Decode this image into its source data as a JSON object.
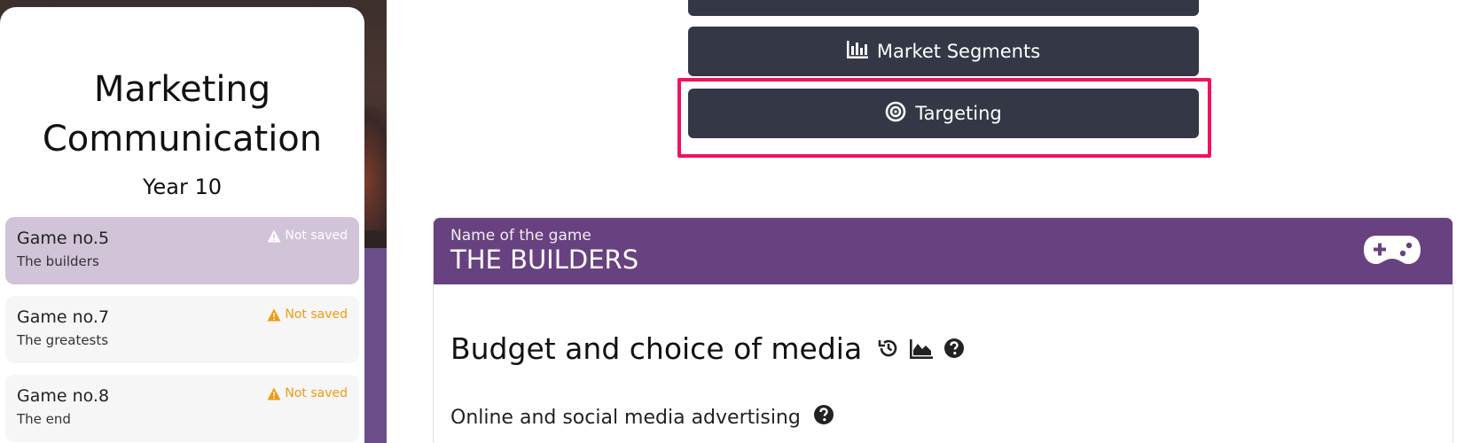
{
  "sidebar": {
    "title": "Marketing Communication",
    "year": "Year 10",
    "games": [
      {
        "title": "Game no.5",
        "subtitle": "The builders",
        "status": "Not saved",
        "active": true
      },
      {
        "title": "Game no.7",
        "subtitle": "The greatests",
        "status": "Not saved",
        "active": false
      },
      {
        "title": "Game no.8",
        "subtitle": "The end",
        "status": "Not saved",
        "active": false
      }
    ]
  },
  "nav_buttons": {
    "segments_label": "Market Segments",
    "targeting_label": "Targeting"
  },
  "game": {
    "name_label": "Name of the game",
    "name": "THE BUILDERS",
    "section_title": "Budget and choice of media",
    "subsection_title": "Online and social media advertising"
  },
  "colors": {
    "nav_button_bg": "#343846",
    "highlight": "#f0145a",
    "header_purple": "#684180",
    "warning_orange": "#f29b0f",
    "active_card": "#d1c3d8"
  }
}
